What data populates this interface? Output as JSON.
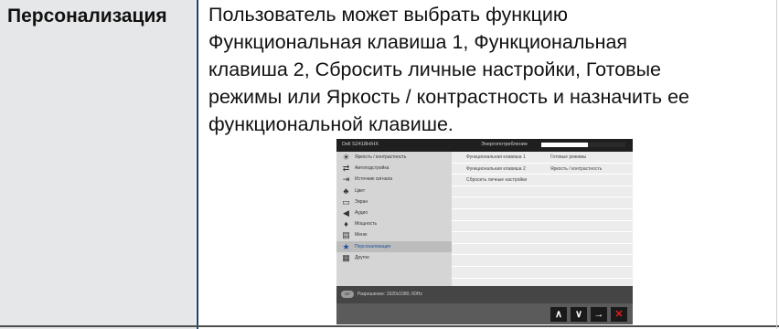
{
  "term": "Персонализация",
  "description_lines": [
    "Пользователь может выбрать функцию",
    "Функциональная клавиша 1, Функциональная",
    "клавиша 2, Сбросить личные настройки, Готовые",
    "режимы или Яркость / контрастность и назначить ее",
    "функциональной клавише."
  ],
  "osd": {
    "model": "Dell S2418H/HX",
    "energy_label": "Энергопотребление",
    "energy_level": 0.55,
    "menu_items": [
      {
        "icon": "brightness-icon",
        "glyph": "☀",
        "label": "Яркость / контрастность"
      },
      {
        "icon": "auto-adjust-icon",
        "glyph": "⇄",
        "label": "Автоподстройка"
      },
      {
        "icon": "input-source-icon",
        "glyph": "⇥",
        "label": "Источник сигнала"
      },
      {
        "icon": "color-icon",
        "glyph": "♣",
        "label": "Цвет"
      },
      {
        "icon": "display-icon",
        "glyph": "▭",
        "label": "Экран"
      },
      {
        "icon": "audio-icon",
        "glyph": "◀",
        "label": "Аудио"
      },
      {
        "icon": "power-icon",
        "glyph": "♦",
        "label": "Мощность"
      },
      {
        "icon": "menu-icon",
        "glyph": "▤",
        "label": "Меню"
      },
      {
        "icon": "personalize-star-icon",
        "glyph": "★",
        "label": "Персонализация",
        "active": true
      },
      {
        "icon": "others-icon",
        "glyph": "▦",
        "label": "Другое"
      }
    ],
    "submenu_rows": [
      {
        "label": "Функциональная клавиша 1",
        "value": "Готовые режимы"
      },
      {
        "label": "Функциональная клавиша 2",
        "value": "Яркость / контрастность"
      },
      {
        "label": "Сбросить личные настройки",
        "value": ""
      },
      {
        "label": "",
        "value": ""
      },
      {
        "label": "",
        "value": ""
      },
      {
        "label": "",
        "value": ""
      },
      {
        "label": "",
        "value": ""
      },
      {
        "label": "",
        "value": ""
      },
      {
        "label": "",
        "value": ""
      },
      {
        "label": "",
        "value": ""
      },
      {
        "label": "",
        "value": ""
      },
      {
        "label": "",
        "value": ""
      }
    ],
    "input_badge": "DP",
    "resolution": "Разрешение: 1920x1080, 60Hz",
    "nav_buttons": [
      {
        "name": "up-button",
        "glyph": "∧"
      },
      {
        "name": "down-button",
        "glyph": "∨"
      },
      {
        "name": "enter-button",
        "glyph": "→"
      },
      {
        "name": "close-button",
        "glyph": "✕"
      }
    ]
  }
}
